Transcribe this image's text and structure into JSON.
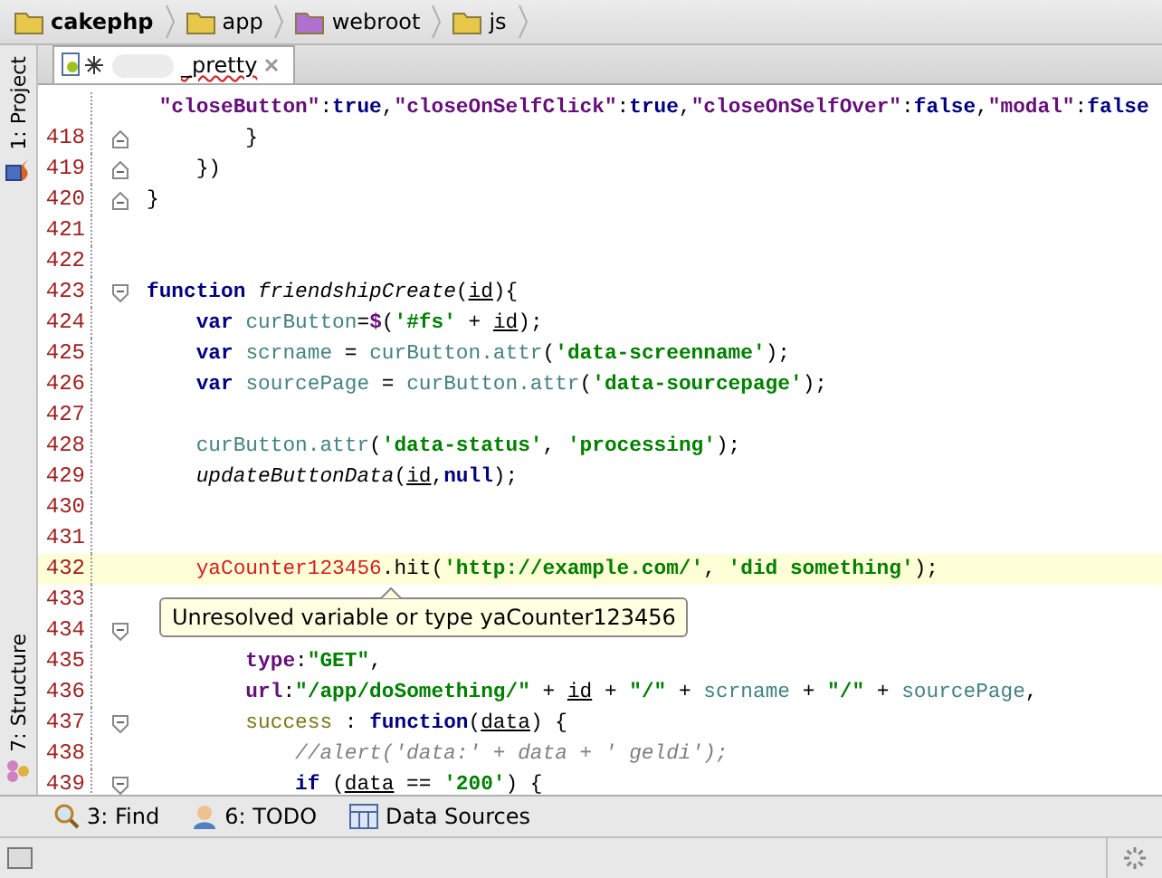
{
  "breadcrumbs": [
    {
      "label": "cakephp",
      "bold": true,
      "color": "#e8c84a"
    },
    {
      "label": "app",
      "bold": false,
      "color": "#e8c84a"
    },
    {
      "label": "webroot",
      "bold": false,
      "color": "#b070d0"
    },
    {
      "label": "js",
      "bold": false,
      "color": "#e8c84a"
    }
  ],
  "tabs": [
    {
      "label": "_pretty",
      "selected": true,
      "name_hidden": true
    }
  ],
  "side_tools": [
    {
      "label": "1: Project",
      "kind": "project"
    },
    {
      "label": "7: Structure",
      "kind": "structure"
    }
  ],
  "editor": {
    "lines": [
      {
        "kind": "plain",
        "current": false,
        "code": [
          {
            "kind": "prop",
            "text": " \"closeButton\""
          },
          {
            "kind": "plain",
            "text": ":"
          },
          {
            "kind": "kw",
            "text": "true"
          },
          {
            "kind": "plain",
            "text": ","
          },
          {
            "kind": "prop",
            "text": "\"closeOnSelfClick\""
          },
          {
            "kind": "plain",
            "text": ":"
          },
          {
            "kind": "kw",
            "text": "true"
          },
          {
            "kind": "plain",
            "text": ","
          },
          {
            "kind": "prop",
            "text": "\"closeOnSelfOver\""
          },
          {
            "kind": "plain",
            "text": ":"
          },
          {
            "kind": "kw",
            "text": "false"
          },
          {
            "kind": "plain",
            "text": ","
          },
          {
            "kind": "prop",
            "text": "\"modal\""
          },
          {
            "kind": "plain",
            "text": ":"
          },
          {
            "kind": "kw",
            "text": "false"
          }
        ]
      },
      {
        "number": "418",
        "kind": "fold_end",
        "current": false,
        "code": [
          {
            "kind": "plain",
            "text": "        }"
          }
        ]
      },
      {
        "number": "419",
        "kind": "fold_end",
        "current": false,
        "code": [
          {
            "kind": "plain",
            "text": "    })"
          }
        ]
      },
      {
        "number": "420",
        "kind": "fold_end",
        "current": false,
        "code": [
          {
            "kind": "plain",
            "text": "}"
          }
        ]
      },
      {
        "number": "421",
        "kind": "plain",
        "current": false
      },
      {
        "number": "422",
        "kind": "plain",
        "current": false
      },
      {
        "number": "423",
        "kind": "fold_start",
        "current": false,
        "code": [
          {
            "kind": "kw",
            "text": "function "
          },
          {
            "kind": "fn",
            "text": "friendshipCreate"
          },
          {
            "kind": "plain",
            "text": "("
          },
          {
            "kind": "param",
            "text": "id"
          },
          {
            "kind": "plain",
            "text": "){"
          }
        ]
      },
      {
        "number": "424",
        "kind": "plain",
        "current": false,
        "code": [
          {
            "kind": "kw",
            "text": "    var "
          },
          {
            "kind": "local",
            "text": "curButton"
          },
          {
            "kind": "plain",
            "text": "="
          },
          {
            "kind": "prop",
            "text": "$"
          },
          {
            "kind": "plain",
            "text": "("
          },
          {
            "kind": "str",
            "text": "'#fs'"
          },
          {
            "kind": "plain",
            "text": " + "
          },
          {
            "kind": "param",
            "text": "id"
          },
          {
            "kind": "plain",
            "text": ");"
          }
        ]
      },
      {
        "number": "425",
        "kind": "plain",
        "current": false,
        "code": [
          {
            "kind": "kw",
            "text": "    var "
          },
          {
            "kind": "local",
            "text": "scrname"
          },
          {
            "kind": "plain",
            "text": " = "
          },
          {
            "kind": "local",
            "text": "curButton.attr"
          },
          {
            "kind": "plain",
            "text": "("
          },
          {
            "kind": "str",
            "text": "'data-screenname'"
          },
          {
            "kind": "plain",
            "text": ");"
          }
        ]
      },
      {
        "number": "426",
        "kind": "plain",
        "current": false,
        "code": [
          {
            "kind": "kw",
            "text": "    var "
          },
          {
            "kind": "local",
            "text": "sourcePage"
          },
          {
            "kind": "plain",
            "text": " = "
          },
          {
            "kind": "local",
            "text": "curButton.attr"
          },
          {
            "kind": "plain",
            "text": "("
          },
          {
            "kind": "str",
            "text": "'data-sourcepage'"
          },
          {
            "kind": "plain",
            "text": ");"
          }
        ]
      },
      {
        "number": "427",
        "kind": "plain",
        "current": false
      },
      {
        "number": "428",
        "kind": "plain",
        "current": false,
        "code": [
          {
            "kind": "local",
            "text": "    curButton.attr"
          },
          {
            "kind": "plain",
            "text": "("
          },
          {
            "kind": "str",
            "text": "'data-status'"
          },
          {
            "kind": "plain",
            "text": ", "
          },
          {
            "kind": "str",
            "text": "'processing'"
          },
          {
            "kind": "plain",
            "text": ");"
          }
        ]
      },
      {
        "number": "429",
        "kind": "plain",
        "current": false,
        "code": [
          {
            "kind": "fn",
            "text": "    updateButtonData"
          },
          {
            "kind": "plain",
            "text": "("
          },
          {
            "kind": "param",
            "text": "id"
          },
          {
            "kind": "plain",
            "text": ","
          },
          {
            "kind": "kw",
            "text": "null"
          },
          {
            "kind": "plain",
            "text": ");"
          }
        ]
      },
      {
        "number": "430",
        "kind": "plain",
        "current": false
      },
      {
        "number": "431",
        "kind": "plain",
        "current": false
      },
      {
        "number": "432",
        "kind": "plain",
        "current": true,
        "code": [
          {
            "kind": "error",
            "text": "    yaCounter123456"
          },
          {
            "kind": "plain",
            "text": ".hit("
          },
          {
            "kind": "str",
            "text": "'http://example.com/'"
          },
          {
            "kind": "plain",
            "text": ", "
          },
          {
            "kind": "str",
            "text": "'did something'"
          },
          {
            "kind": "plain",
            "text": ");"
          }
        ]
      },
      {
        "number": "433",
        "kind": "plain",
        "current": false
      },
      {
        "number": "434",
        "kind": "fold_start",
        "current": false
      },
      {
        "number": "435",
        "kind": "plain",
        "current": false,
        "code": [
          {
            "kind": "prop",
            "text": "        type"
          },
          {
            "kind": "plain",
            "text": ":"
          },
          {
            "kind": "str",
            "text": "\"GET\""
          },
          {
            "kind": "plain",
            "text": ","
          }
        ]
      },
      {
        "number": "436",
        "kind": "plain",
        "current": false,
        "code": [
          {
            "kind": "prop",
            "text": "        url"
          },
          {
            "kind": "plain",
            "text": ":"
          },
          {
            "kind": "str",
            "text": "\"/app/doSomething/\""
          },
          {
            "kind": "plain",
            "text": " + "
          },
          {
            "kind": "param",
            "text": "id"
          },
          {
            "kind": "plain",
            "text": " + "
          },
          {
            "kind": "str",
            "text": "\"/\""
          },
          {
            "kind": "plain",
            "text": " + "
          },
          {
            "kind": "local",
            "text": "scrname"
          },
          {
            "kind": "plain",
            "text": " + "
          },
          {
            "kind": "str",
            "text": "\"/\""
          },
          {
            "kind": "plain",
            "text": " + "
          },
          {
            "kind": "local",
            "text": "sourcePage"
          },
          {
            "kind": "plain",
            "text": ","
          }
        ]
      },
      {
        "number": "437",
        "kind": "fold_start",
        "current": false,
        "code": [
          {
            "kind": "member",
            "text": "        success"
          },
          {
            "kind": "plain",
            "text": " : "
          },
          {
            "kind": "kw",
            "text": "function"
          },
          {
            "kind": "plain",
            "text": "("
          },
          {
            "kind": "param",
            "text": "data"
          },
          {
            "kind": "plain",
            "text": ") {"
          }
        ]
      },
      {
        "number": "438",
        "kind": "plain",
        "current": false,
        "code": [
          {
            "kind": "comment",
            "text": "            //alert('data:' + data + ' geldi');"
          }
        ]
      },
      {
        "number": "439",
        "kind": "fold_start",
        "current": false,
        "code": [
          {
            "kind": "kw",
            "text": "            if"
          },
          {
            "kind": "plain",
            "text": " ("
          },
          {
            "kind": "param",
            "text": "data"
          },
          {
            "kind": "plain",
            "text": " == "
          },
          {
            "kind": "str",
            "text": "'200'"
          },
          {
            "kind": "plain",
            "text": ") {"
          }
        ]
      }
    ],
    "tooltip": "Unresolved variable or type yaCounter123456"
  },
  "tool_buttons": [
    {
      "label": "3: Find",
      "kind": "find"
    },
    {
      "label": "6: TODO",
      "kind": "todo"
    },
    {
      "label": "Data Sources",
      "kind": "datasources"
    }
  ]
}
